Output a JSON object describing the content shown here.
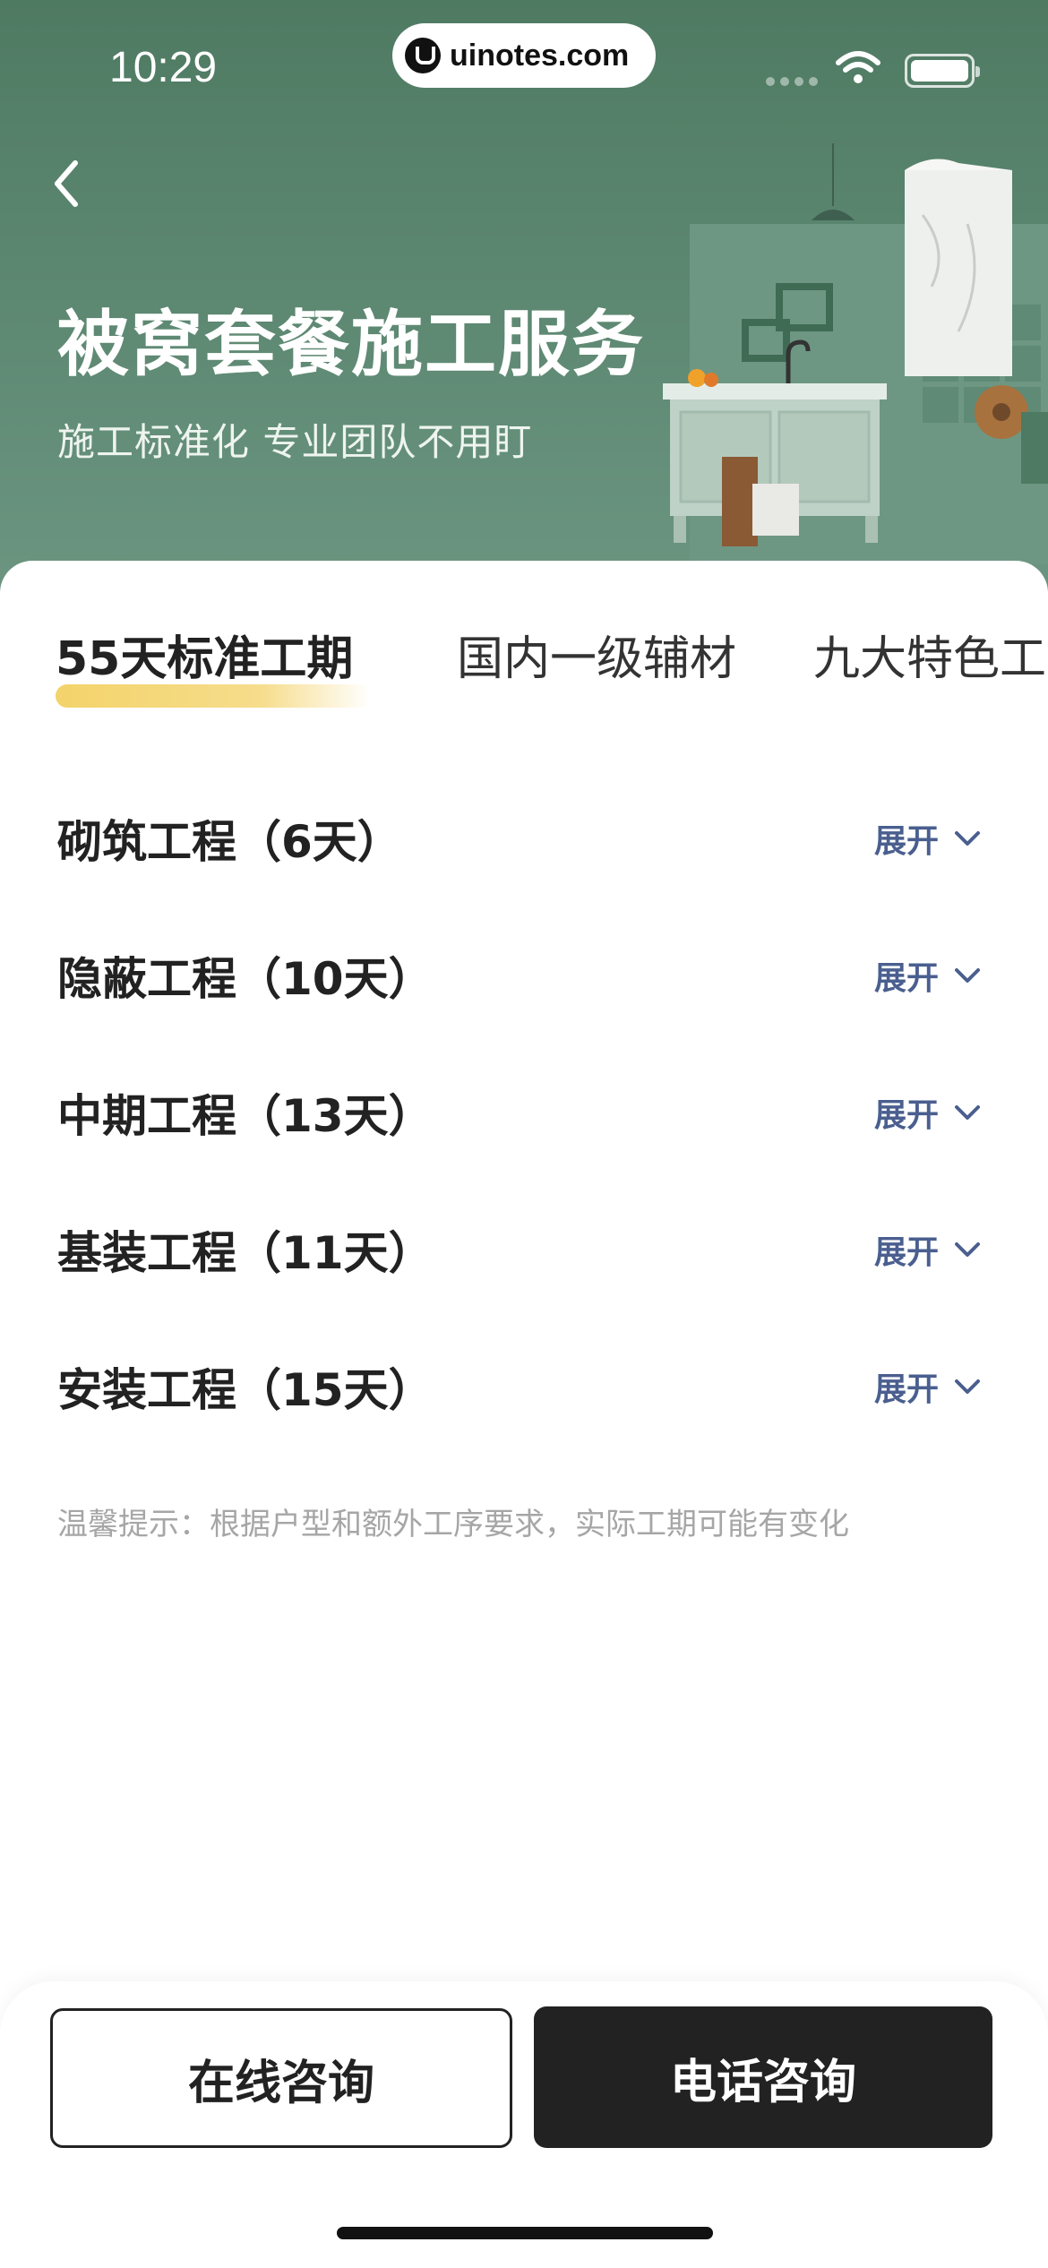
{
  "status_bar": {
    "time": "10:29",
    "url": "uinotes.com"
  },
  "header": {
    "back_icon": "chevron-left-icon",
    "share_icon": "share-icon",
    "title": "被窝套餐施工服务",
    "subtitle": "施工标准化 专业团队不用盯"
  },
  "tabs": [
    {
      "label": "55天标准工期",
      "active": true
    },
    {
      "label": "国内一级辅材",
      "active": false
    },
    {
      "label": "九大特色工艺",
      "active": false
    }
  ],
  "stages": [
    {
      "title": "砌筑工程（6天）",
      "expand_label": "展开"
    },
    {
      "title": "隐蔽工程（10天）",
      "expand_label": "展开"
    },
    {
      "title": "中期工程（13天）",
      "expand_label": "展开"
    },
    {
      "title": "基装工程（11天）",
      "expand_label": "展开"
    },
    {
      "title": "安装工程（15天）",
      "expand_label": "展开"
    }
  ],
  "tip": "温馨提示：根据户型和额外工序要求，实际工期可能有变化",
  "actions": {
    "online_label": "在线咨询",
    "phone_label": "电话咨询"
  },
  "colors": {
    "hero_green": "#5b8670",
    "tab_highlight": "#f3d36a",
    "expand_blue": "#4a5f8f",
    "primary_button": "#222222"
  }
}
